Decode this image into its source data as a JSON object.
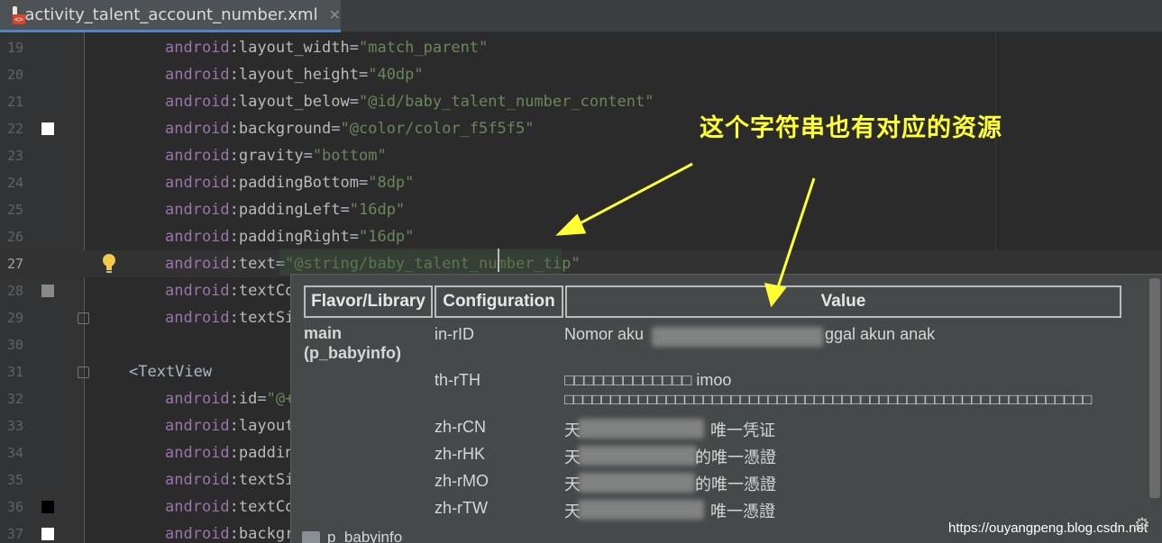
{
  "tab": {
    "title": "activity_talent_account_number.xml",
    "close_glyph": "✕",
    "icon": "xml-file-icon",
    "badge": "<>"
  },
  "editor": {
    "lines": [
      {
        "num": "19",
        "ns": "android",
        "attr": "layout_width",
        "val": "\"match_parent\""
      },
      {
        "num": "20",
        "ns": "android",
        "attr": "layout_height",
        "val": "\"40dp\""
      },
      {
        "num": "21",
        "ns": "android",
        "attr": "layout_below",
        "val": "\"@id/baby_talent_number_content\""
      },
      {
        "num": "22",
        "ns": "android",
        "attr": "background",
        "val": "\"@color/color_f5f5f5\"",
        "swatch": "#ffffff"
      },
      {
        "num": "23",
        "ns": "android",
        "attr": "gravity",
        "val": "\"bottom\""
      },
      {
        "num": "24",
        "ns": "android",
        "attr": "paddingBottom",
        "val": "\"8dp\""
      },
      {
        "num": "25",
        "ns": "android",
        "attr": "paddingLeft",
        "val": "\"16dp\""
      },
      {
        "num": "26",
        "ns": "android",
        "attr": "paddingRight",
        "val": "\"16dp\""
      },
      {
        "num": "27",
        "ns": "android",
        "attr": "text",
        "val": "\"@string/baby_talent_number_tip\""
      },
      {
        "num": "28",
        "ns": "android",
        "attr": "textCo",
        "val": "",
        "swatch": "#8a8a8a"
      },
      {
        "num": "29",
        "ns": "android",
        "attr": "textSi",
        "val": ""
      },
      {
        "num": "30",
        "ns": "",
        "attr": "",
        "val": ""
      },
      {
        "num": "31",
        "tag": "<TextView"
      },
      {
        "num": "32",
        "ns": "android",
        "attr": "id",
        "val": "\"@+"
      },
      {
        "num": "33",
        "ns": "android",
        "attr": "layout",
        "val": ""
      },
      {
        "num": "34",
        "ns": "android",
        "attr": "paddin",
        "val": ""
      },
      {
        "num": "35",
        "ns": "android",
        "attr": "textSi",
        "val": ""
      },
      {
        "num": "36",
        "ns": "android",
        "attr": "textCo",
        "val": "",
        "swatch": "#000000"
      },
      {
        "num": "37",
        "ns": "android",
        "attr": "backgr",
        "val": "",
        "swatch": "#ffffff"
      }
    ]
  },
  "popup": {
    "headers": [
      "Flavor/Library",
      "Configuration",
      "Value"
    ],
    "flavor": "main\n(p_babyinfo)",
    "rows": [
      {
        "config": "in-rID",
        "value_start": "Nomor aku",
        "value_end": "ggal akun anak"
      },
      {
        "config": "th-rTH",
        "value_start": "□□□□□□□□□□□□□ imoo",
        "value_line2": "□□□□□□□□□□□□□□□□□□□□□□□□□□□□□□□□□□□□□□□□□□□□□□□□□□□□□□□□□"
      },
      {
        "config": "zh-rCN",
        "value_start": "天",
        "value_end": "唯一凭证"
      },
      {
        "config": "zh-rHK",
        "value_start": "天",
        "value_end": "的唯一憑證"
      },
      {
        "config": "zh-rMO",
        "value_start": "天",
        "value_end": "的唯一憑證"
      },
      {
        "config": "zh-rTW",
        "value_start": "天",
        "value_end": "唯一憑證"
      }
    ],
    "folder": "p_babyinfo"
  },
  "annotation": {
    "text": "这个字符串也有对应的资源",
    "color": "#ffff33"
  },
  "watermark": "https://ouyangpeng.blog.csdn.net",
  "colors": {
    "attr_ns": "#9876aa",
    "string": "#6a8759",
    "tag": "#e8bf6a",
    "accent": "#4a88c7"
  }
}
